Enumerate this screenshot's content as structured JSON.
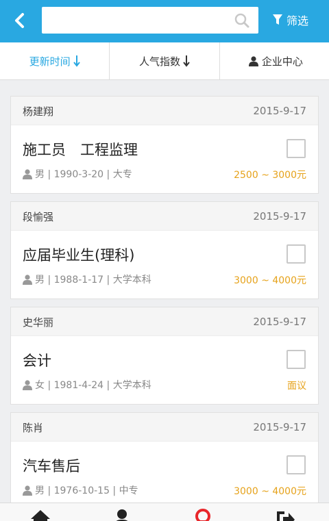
{
  "header": {
    "search_placeholder": "",
    "filter_label": "筛选"
  },
  "sort_tabs": [
    {
      "label": "更新时间",
      "active": true
    },
    {
      "label": "人气指数",
      "active": false
    },
    {
      "label": "企业中心",
      "active": false
    }
  ],
  "resumes": [
    {
      "name": "杨建翔",
      "date": "2015-9-17",
      "title": "施工员　工程监理",
      "meta": "男 | 1990-3-20 | 大专",
      "salary": "2500 ~ 3000元"
    },
    {
      "name": "段愉强",
      "date": "2015-9-17",
      "title": "应届毕业生(理科)",
      "meta": "男 | 1988-1-17 | 大学本科",
      "salary": "3000 ~ 4000元"
    },
    {
      "name": "史华丽",
      "date": "2015-9-17",
      "title": "会计",
      "meta": "女 | 1981-4-24 | 大学本科",
      "salary": "面议"
    },
    {
      "name": "陈肖",
      "date": "2015-9-17",
      "title": "汽车售后",
      "meta": "男 | 1976-10-15 | 中专",
      "salary": "3000 ~ 4000元"
    }
  ],
  "colors": {
    "accent": "#29a8e1",
    "salary": "#e6a21a",
    "location_pin": "#e8262a"
  },
  "icons": [
    "back-arrow-icon",
    "search-icon",
    "filter-icon",
    "arrow-down-icon",
    "user-icon",
    "home-icon",
    "location-pin-icon",
    "logout-icon"
  ]
}
